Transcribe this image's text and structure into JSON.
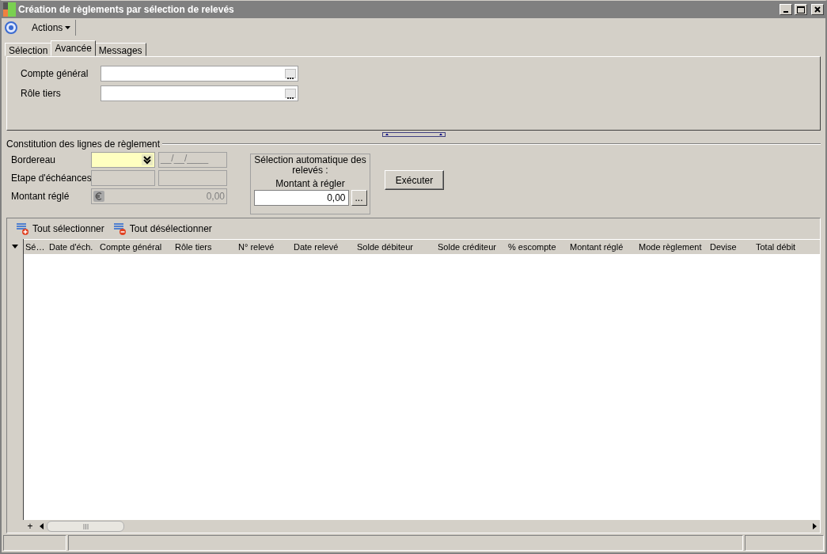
{
  "window": {
    "title": "Création de règlements par sélection de relevés"
  },
  "toolbar": {
    "menu": "Actions"
  },
  "tabs": [
    {
      "label": "Sélection",
      "selected": false
    },
    {
      "label": "Avancée",
      "selected": true
    },
    {
      "label": "Messages",
      "selected": false
    }
  ],
  "advanced_fields": [
    {
      "label": "Compte général"
    },
    {
      "label": "Rôle tiers"
    }
  ],
  "section": {
    "title": "Constitution des lignes de règlement",
    "bordereau": {
      "label": "Bordereau",
      "date": "__/__/____"
    },
    "etape": {
      "label": "Etape d'échéances"
    },
    "montant": {
      "label": "Montant réglé",
      "value": "0,00"
    },
    "auto": {
      "title": "Sélection automatique des relevés :",
      "amount_label": "Montant à régler",
      "amount": "0,00",
      "browse": "..."
    },
    "execute": "Exécuter"
  },
  "grid": {
    "actions": [
      "Tout sélectionner",
      "Tout désélectionner"
    ],
    "columns": [
      "Sé…",
      "Date d'éch.",
      "Compte général",
      "Rôle tiers",
      "N° relevé",
      "Date relevé",
      "Solde débiteur",
      "Solde créditeur",
      "% escompte",
      "Montant réglé",
      "Mode règlement",
      "Devise",
      "Total débit"
    ],
    "expand": "+"
  }
}
